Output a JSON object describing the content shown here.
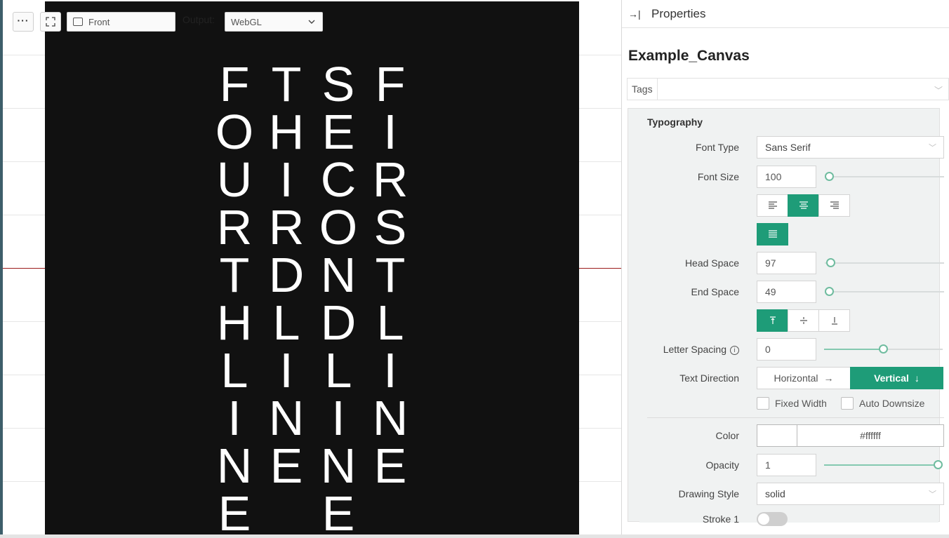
{
  "toolbar": {
    "more_icon": "ellipsis-icon",
    "fullscreen_icon": "fullscreen-icon",
    "camera_value": "Front",
    "output_label": "Output:",
    "output_value": "WebGL"
  },
  "canvas": {
    "background": "#111111",
    "text_color": "#ffffff",
    "columns": [
      {
        "letters": [
          "F",
          "O",
          "U",
          "R",
          "T",
          "H",
          "L",
          "I",
          "N",
          "E"
        ]
      },
      {
        "letters": [
          "T",
          "H",
          "I",
          "R",
          "D",
          "L",
          "I",
          "N",
          "E"
        ]
      },
      {
        "letters": [
          "S",
          "E",
          "C",
          "O",
          "N",
          "D",
          "L",
          "I",
          "N",
          "E"
        ]
      },
      {
        "letters": [
          "F",
          "I",
          "R",
          "S",
          "T",
          "L",
          "I",
          "N",
          "E"
        ]
      }
    ]
  },
  "panel": {
    "title": "Properties",
    "object_name": "Example_Canvas",
    "tags_label": "Tags",
    "section_title": "Typography",
    "font_type": {
      "label": "Font Type",
      "value": "Sans Serif"
    },
    "font_size": {
      "label": "Font Size",
      "value": "100"
    },
    "head_space": {
      "label": "Head Space",
      "value": "97"
    },
    "end_space": {
      "label": "End Space",
      "value": "49"
    },
    "letter_spacing": {
      "label": "Letter Spacing",
      "value": "0",
      "slider_fraction": 0.5
    },
    "text_direction": {
      "label": "Text Direction",
      "horizontal": "Horizontal",
      "vertical": "Vertical",
      "selected": "Vertical"
    },
    "fixed_width": {
      "label": "Fixed Width",
      "checked": false
    },
    "auto_downsize": {
      "label": "Auto Downsize",
      "checked": false
    },
    "color": {
      "label": "Color",
      "value": "#ffffff"
    },
    "opacity": {
      "label": "Opacity",
      "value": "1",
      "slider_fraction": 1.0
    },
    "drawing_style": {
      "label": "Drawing Style",
      "value": "solid"
    },
    "stroke": {
      "label": "Stroke 1",
      "on": false
    },
    "accent": "#1e9c78"
  }
}
